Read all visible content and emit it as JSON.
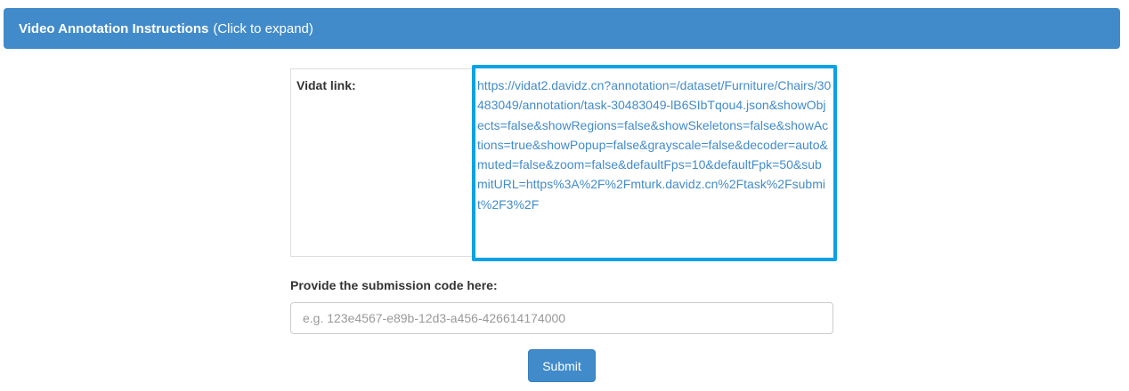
{
  "header": {
    "title": "Video Annotation Instructions",
    "hint": "(Click to expand)"
  },
  "vidat": {
    "label": "Vidat link:",
    "url": "https://vidat2.davidz.cn?annotation=/dataset/Furniture/Chairs/30483049/annotation/task-30483049-lB6SIbTqou4.json&showObjects=false&showRegions=false&showSkeletons=false&showActions=true&showPopup=false&grayscale=false&decoder=auto&muted=false&zoom=false&defaultFps=10&defaultFpk=50&submitURL=https%3A%2F%2Fmturk.davidz.cn%2Ftask%2Fsubmit%2F3%2F"
  },
  "submission": {
    "label": "Provide the submission code here:",
    "placeholder": "e.g. 123e4567-e89b-12d3-a456-426614174000",
    "value": ""
  },
  "submit_button": {
    "label": "Submit"
  },
  "colors": {
    "primary": "#428bca",
    "highlight_border": "#0aa2e4"
  }
}
